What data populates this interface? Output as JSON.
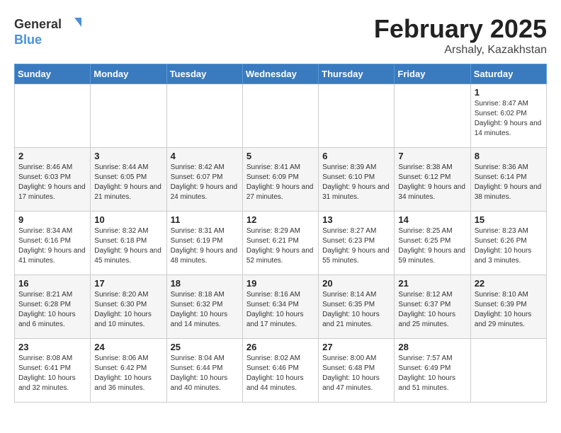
{
  "header": {
    "logo_general": "General",
    "logo_blue": "Blue",
    "title": "February 2025",
    "subtitle": "Arshaly, Kazakhstan"
  },
  "days_of_week": [
    "Sunday",
    "Monday",
    "Tuesday",
    "Wednesday",
    "Thursday",
    "Friday",
    "Saturday"
  ],
  "weeks": [
    [
      {
        "day": "",
        "info": ""
      },
      {
        "day": "",
        "info": ""
      },
      {
        "day": "",
        "info": ""
      },
      {
        "day": "",
        "info": ""
      },
      {
        "day": "",
        "info": ""
      },
      {
        "day": "",
        "info": ""
      },
      {
        "day": "1",
        "info": "Sunrise: 8:47 AM\nSunset: 6:02 PM\nDaylight: 9 hours and 14 minutes."
      }
    ],
    [
      {
        "day": "2",
        "info": "Sunrise: 8:46 AM\nSunset: 6:03 PM\nDaylight: 9 hours and 17 minutes."
      },
      {
        "day": "3",
        "info": "Sunrise: 8:44 AM\nSunset: 6:05 PM\nDaylight: 9 hours and 21 minutes."
      },
      {
        "day": "4",
        "info": "Sunrise: 8:42 AM\nSunset: 6:07 PM\nDaylight: 9 hours and 24 minutes."
      },
      {
        "day": "5",
        "info": "Sunrise: 8:41 AM\nSunset: 6:09 PM\nDaylight: 9 hours and 27 minutes."
      },
      {
        "day": "6",
        "info": "Sunrise: 8:39 AM\nSunset: 6:10 PM\nDaylight: 9 hours and 31 minutes."
      },
      {
        "day": "7",
        "info": "Sunrise: 8:38 AM\nSunset: 6:12 PM\nDaylight: 9 hours and 34 minutes."
      },
      {
        "day": "8",
        "info": "Sunrise: 8:36 AM\nSunset: 6:14 PM\nDaylight: 9 hours and 38 minutes."
      }
    ],
    [
      {
        "day": "9",
        "info": "Sunrise: 8:34 AM\nSunset: 6:16 PM\nDaylight: 9 hours and 41 minutes."
      },
      {
        "day": "10",
        "info": "Sunrise: 8:32 AM\nSunset: 6:18 PM\nDaylight: 9 hours and 45 minutes."
      },
      {
        "day": "11",
        "info": "Sunrise: 8:31 AM\nSunset: 6:19 PM\nDaylight: 9 hours and 48 minutes."
      },
      {
        "day": "12",
        "info": "Sunrise: 8:29 AM\nSunset: 6:21 PM\nDaylight: 9 hours and 52 minutes."
      },
      {
        "day": "13",
        "info": "Sunrise: 8:27 AM\nSunset: 6:23 PM\nDaylight: 9 hours and 55 minutes."
      },
      {
        "day": "14",
        "info": "Sunrise: 8:25 AM\nSunset: 6:25 PM\nDaylight: 9 hours and 59 minutes."
      },
      {
        "day": "15",
        "info": "Sunrise: 8:23 AM\nSunset: 6:26 PM\nDaylight: 10 hours and 3 minutes."
      }
    ],
    [
      {
        "day": "16",
        "info": "Sunrise: 8:21 AM\nSunset: 6:28 PM\nDaylight: 10 hours and 6 minutes."
      },
      {
        "day": "17",
        "info": "Sunrise: 8:20 AM\nSunset: 6:30 PM\nDaylight: 10 hours and 10 minutes."
      },
      {
        "day": "18",
        "info": "Sunrise: 8:18 AM\nSunset: 6:32 PM\nDaylight: 10 hours and 14 minutes."
      },
      {
        "day": "19",
        "info": "Sunrise: 8:16 AM\nSunset: 6:34 PM\nDaylight: 10 hours and 17 minutes."
      },
      {
        "day": "20",
        "info": "Sunrise: 8:14 AM\nSunset: 6:35 PM\nDaylight: 10 hours and 21 minutes."
      },
      {
        "day": "21",
        "info": "Sunrise: 8:12 AM\nSunset: 6:37 PM\nDaylight: 10 hours and 25 minutes."
      },
      {
        "day": "22",
        "info": "Sunrise: 8:10 AM\nSunset: 6:39 PM\nDaylight: 10 hours and 29 minutes."
      }
    ],
    [
      {
        "day": "23",
        "info": "Sunrise: 8:08 AM\nSunset: 6:41 PM\nDaylight: 10 hours and 32 minutes."
      },
      {
        "day": "24",
        "info": "Sunrise: 8:06 AM\nSunset: 6:42 PM\nDaylight: 10 hours and 36 minutes."
      },
      {
        "day": "25",
        "info": "Sunrise: 8:04 AM\nSunset: 6:44 PM\nDaylight: 10 hours and 40 minutes."
      },
      {
        "day": "26",
        "info": "Sunrise: 8:02 AM\nSunset: 6:46 PM\nDaylight: 10 hours and 44 minutes."
      },
      {
        "day": "27",
        "info": "Sunrise: 8:00 AM\nSunset: 6:48 PM\nDaylight: 10 hours and 47 minutes."
      },
      {
        "day": "28",
        "info": "Sunrise: 7:57 AM\nSunset: 6:49 PM\nDaylight: 10 hours and 51 minutes."
      },
      {
        "day": "",
        "info": ""
      }
    ]
  ]
}
